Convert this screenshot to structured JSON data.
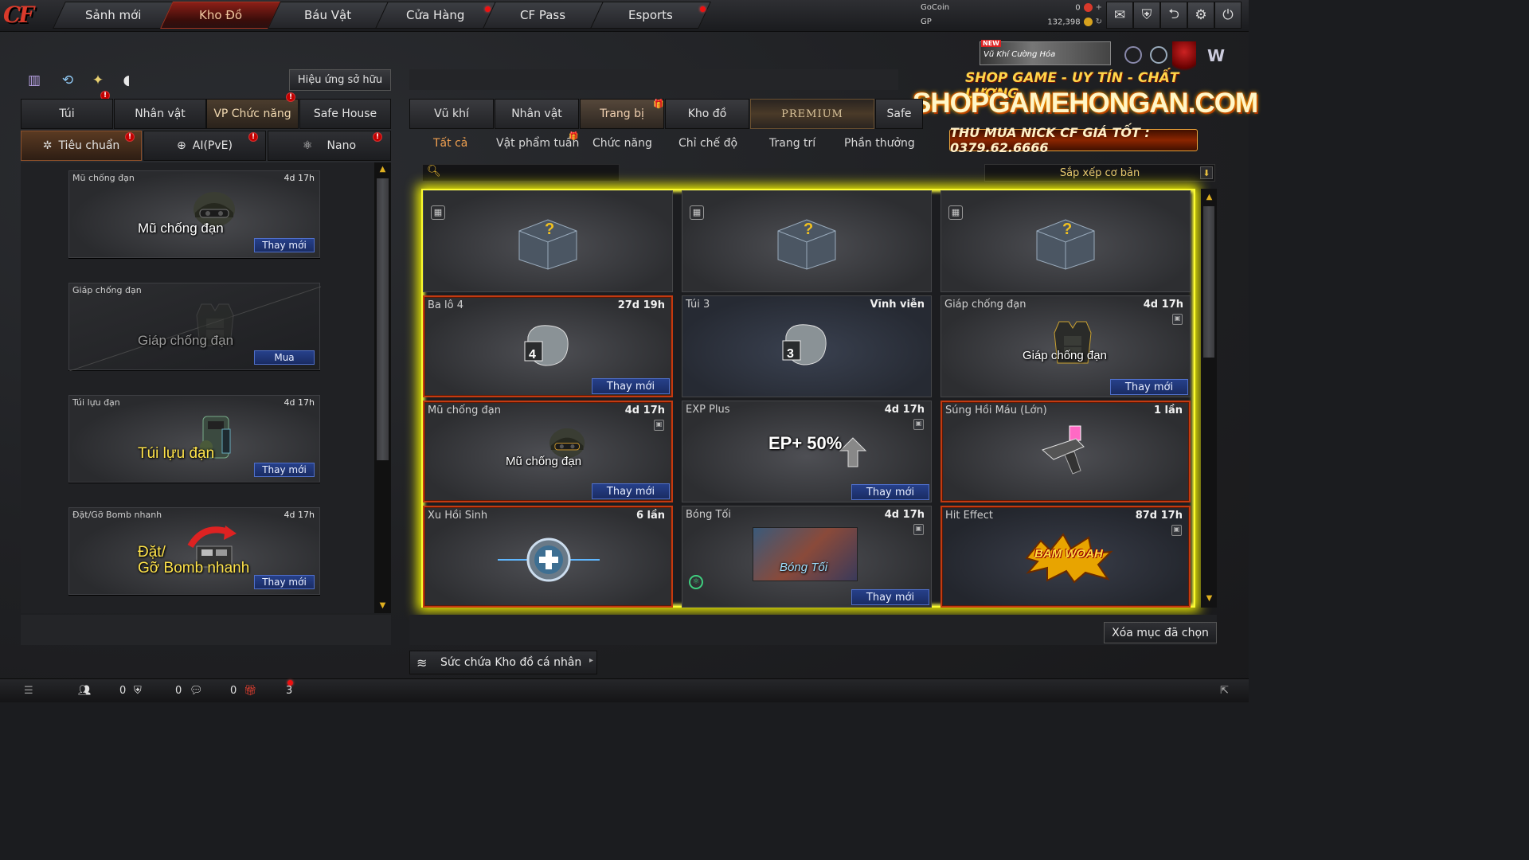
{
  "top_nav": {
    "logo": "CF",
    "tabs": [
      {
        "label": "Sảnh mới"
      },
      {
        "label": "Kho Đồ"
      },
      {
        "label": "Báu Vật"
      },
      {
        "label": "Cửa Hàng"
      },
      {
        "label": "CF Pass"
      },
      {
        "label": "Esports"
      }
    ],
    "currency": {
      "gocoin_label": "GoCoin",
      "gocoin_value": "0",
      "gp_label": "GP",
      "gp_value": "132,398"
    },
    "icons": [
      "mail-icon",
      "shield-icon",
      "share-icon",
      "gear-icon",
      "power-icon"
    ]
  },
  "banner": {
    "new_badge": "NEW",
    "weapon_strip": "Vũ Khí Cường Hóa",
    "tagline": "SHOP GAME - UY TÍN - CHẤT LƯỢNG",
    "site": "SHOPGAMEHONGAN.COM",
    "hotline": "THU MUA NICK CF GIÁ TỐT : 0379.62.6666"
  },
  "left_panel": {
    "effect_button": "Hiệu ứng sở hữu",
    "tabs": [
      "Túi",
      "Nhân vật",
      "VP Chức năng",
      "Safe House"
    ],
    "subtabs": [
      "Tiêu chuẩn",
      "AI(PvE)",
      "Nano"
    ],
    "slots": [
      {
        "name": "Mũ chống đạn",
        "time": "4d 17h",
        "caption": "Mũ chống đạn",
        "action": "Thay mới"
      },
      {
        "name": "Giáp chống đạn",
        "time": "",
        "caption": "Giáp chống đạn",
        "action": "Mua"
      },
      {
        "name": "Túi lựu đạn",
        "time": "4d 17h",
        "caption": "Túi lựu đạn",
        "action": "Thay mới"
      },
      {
        "name": "Đặt/Gỡ Bomb nhanh",
        "time": "4d 17h",
        "caption_line1": "Đặt/",
        "caption_line2": "Gỡ Bomb nhanh",
        "action": "Thay mới"
      }
    ]
  },
  "right_panel": {
    "tabs": [
      "Vũ khí",
      "Nhân vật",
      "Trang bị",
      "Kho đồ",
      "PREMIUM",
      "Safe"
    ],
    "categories": [
      "Tất cả",
      "Vật phẩm tuần",
      "Chức năng",
      "Chỉ chế độ",
      "Trang trí",
      "Phần thưởng"
    ],
    "search_placeholder": "",
    "sort_label": "Sắp xếp cơ bản",
    "items": [
      {
        "name": "",
        "time": "",
        "action": ""
      },
      {
        "name": "",
        "time": "",
        "action": ""
      },
      {
        "name": "",
        "time": "",
        "action": ""
      },
      {
        "name": "Ba lô 4",
        "time": "27d 19h",
        "action": "Thay mới"
      },
      {
        "name": "Túi 3",
        "time": "Vĩnh viễn",
        "action": ""
      },
      {
        "name": "Giáp chống đạn",
        "time": "4d 17h",
        "caption": "Giáp chống đạn",
        "action": "Thay mới"
      },
      {
        "name": "Mũ chống đạn",
        "time": "4d 17h",
        "caption": "Mũ chống đạn",
        "action": "Thay mới"
      },
      {
        "name": "EXP Plus",
        "time": "4d 17h",
        "caption": "EP+ 50%",
        "action": "Thay mới"
      },
      {
        "name": "Súng Hồi Máu (Lớn)",
        "time": "1 lần",
        "action": ""
      },
      {
        "name": "Xu Hồi Sinh",
        "time": "6 lần",
        "action": ""
      },
      {
        "name": "Bóng Tối",
        "time": "4d 17h",
        "caption": "Bóng Tối",
        "action": "Thay mới"
      },
      {
        "name": "Hit Effect",
        "time": "87d 17h",
        "caption": "BAM WOAH",
        "action": ""
      }
    ],
    "clear_button": "Xóa mục đã chọn",
    "capacity_label": "Sức chứa Kho đồ cá nhân"
  },
  "bottom_bar": {
    "counts": [
      "0",
      "0",
      "0",
      "3"
    ]
  },
  "colors": {
    "accent_red": "#8b1f17",
    "highlight_yellow": "#fafa30",
    "button_blue": "#26408a",
    "selected_orange": "#c43a10"
  }
}
